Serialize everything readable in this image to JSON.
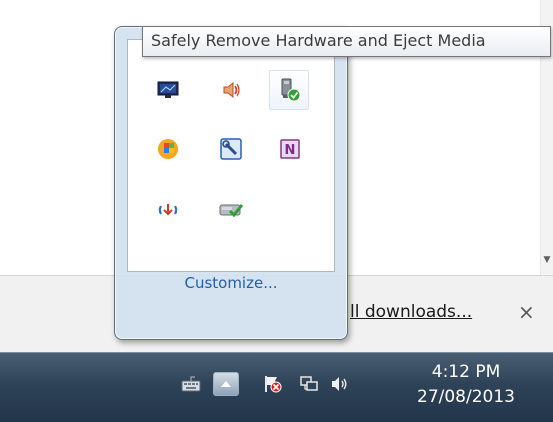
{
  "tooltip": {
    "text": "Safely Remove Hardware and Eject Media"
  },
  "flyout": {
    "customize_label": "Customize...",
    "icons": [
      {
        "name": "display-icon"
      },
      {
        "name": "speaker-muted-icon"
      },
      {
        "name": "safely-remove-hardware-icon"
      },
      {
        "name": "windows-update-icon"
      },
      {
        "name": "tool-wrench-icon"
      },
      {
        "name": "onenote-icon"
      },
      {
        "name": "sync-icon"
      },
      {
        "name": "drive-check-icon"
      }
    ]
  },
  "background": {
    "downloads_link": "ll downloads...",
    "close_label": "×"
  },
  "taskbar": {
    "time": "4:12 PM",
    "date": "27/08/2013",
    "tray_icons": [
      "keyboard-icon",
      "show-hidden-icons-icon",
      "action-center-flag-icon",
      "network-icon",
      "volume-icon"
    ]
  },
  "colors": {
    "link": "#2060a8",
    "taskbar": "#2f4358"
  }
}
